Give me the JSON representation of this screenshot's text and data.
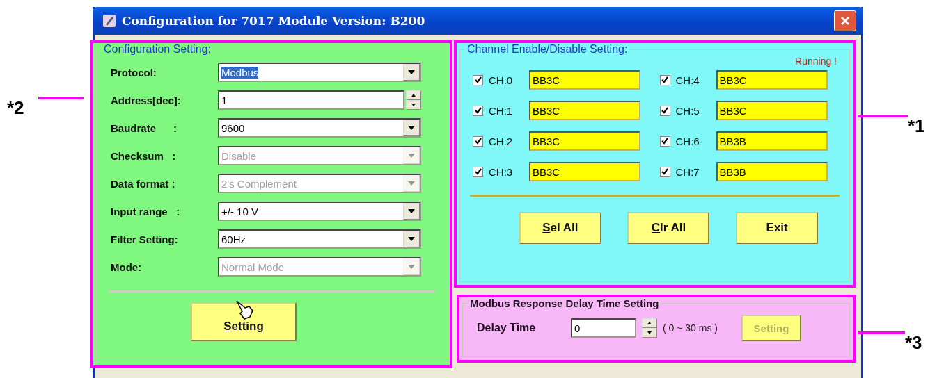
{
  "window": {
    "title": "Configuration for 7017 Module Version: B200"
  },
  "annotations": [
    {
      "label": "*2"
    },
    {
      "label": "*1"
    },
    {
      "label": "*3"
    }
  ],
  "configuration": {
    "legend": "Configuration Setting:",
    "fields": [
      {
        "label": "Protocol:",
        "value": "Modbus",
        "kind": "dropdown",
        "disabled": false,
        "highlighted": true
      },
      {
        "label": "Address[dec]:",
        "value": "1",
        "kind": "spinner",
        "disabled": false,
        "highlighted": false
      },
      {
        "label": "Baudrate      :",
        "value": "9600",
        "kind": "dropdown",
        "disabled": false,
        "highlighted": false
      },
      {
        "label": "Checksum   :",
        "value": "Disable",
        "kind": "dropdown",
        "disabled": true,
        "highlighted": false
      },
      {
        "label": "Data format :",
        "value": "2's Complement",
        "kind": "dropdown",
        "disabled": true,
        "highlighted": false
      },
      {
        "label": "Input range   :",
        "value": "+/- 10 V",
        "kind": "dropdown",
        "disabled": false,
        "highlighted": false
      },
      {
        "label": "Filter Setting:",
        "value": "60Hz",
        "kind": "dropdown",
        "disabled": false,
        "highlighted": false
      },
      {
        "label": "Mode:",
        "value": "Normal Mode",
        "kind": "dropdown",
        "disabled": true,
        "highlighted": false
      }
    ],
    "button": {
      "label": "Setting",
      "underline_first": true
    }
  },
  "channels": {
    "legend": "Channel Enable/Disable Setting:",
    "status": "Running !",
    "items": [
      {
        "label": "CH:0",
        "checked": true,
        "value": "BB3C"
      },
      {
        "label": "CH:1",
        "checked": true,
        "value": "BB3C"
      },
      {
        "label": "CH:2",
        "checked": true,
        "value": "BB3C"
      },
      {
        "label": "CH:3",
        "checked": true,
        "value": "BB3C"
      },
      {
        "label": "CH:4",
        "checked": true,
        "value": "BB3C"
      },
      {
        "label": "CH:5",
        "checked": true,
        "value": "BB3C"
      },
      {
        "label": "CH:6",
        "checked": true,
        "value": "BB3B"
      },
      {
        "label": "CH:7",
        "checked": true,
        "value": "BB3B"
      }
    ],
    "buttons": [
      {
        "label": "Sel All",
        "underline_first": true
      },
      {
        "label": "Clr All",
        "underline_first": true
      },
      {
        "label": "Exit",
        "underline_first": false
      }
    ]
  },
  "delay": {
    "legend": "Modbus Response Delay Time Setting",
    "label": "Delay Time",
    "value": "0",
    "range": "( 0 ~ 30 ms )",
    "button": {
      "label": "Setting",
      "disabled": true
    }
  }
}
